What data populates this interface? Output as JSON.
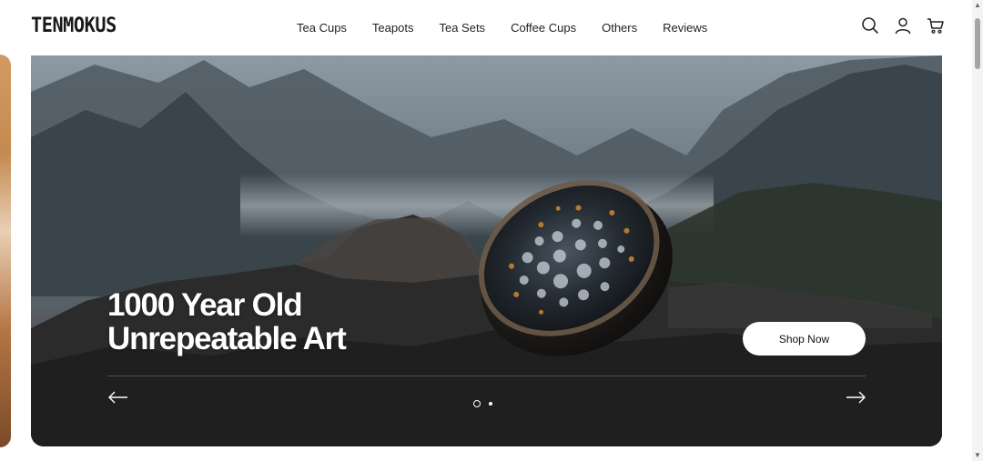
{
  "header": {
    "logo": "TENMOKUS",
    "nav": [
      {
        "label": "Tea Cups"
      },
      {
        "label": "Teapots"
      },
      {
        "label": "Tea Sets"
      },
      {
        "label": "Coffee Cups"
      },
      {
        "label": "Others"
      },
      {
        "label": "Reviews"
      }
    ],
    "icons": [
      "search-icon",
      "account-icon",
      "cart-icon"
    ]
  },
  "hero": {
    "headline_line1": "1000 Year Old",
    "headline_line2": "Unrepeatable Art",
    "cta_label": "Shop Now",
    "slide_count": 2,
    "active_slide": 1
  },
  "colors": {
    "text_dark": "#111111",
    "button_bg": "#ffffff",
    "hero_overlay_text": "#ffffff"
  }
}
